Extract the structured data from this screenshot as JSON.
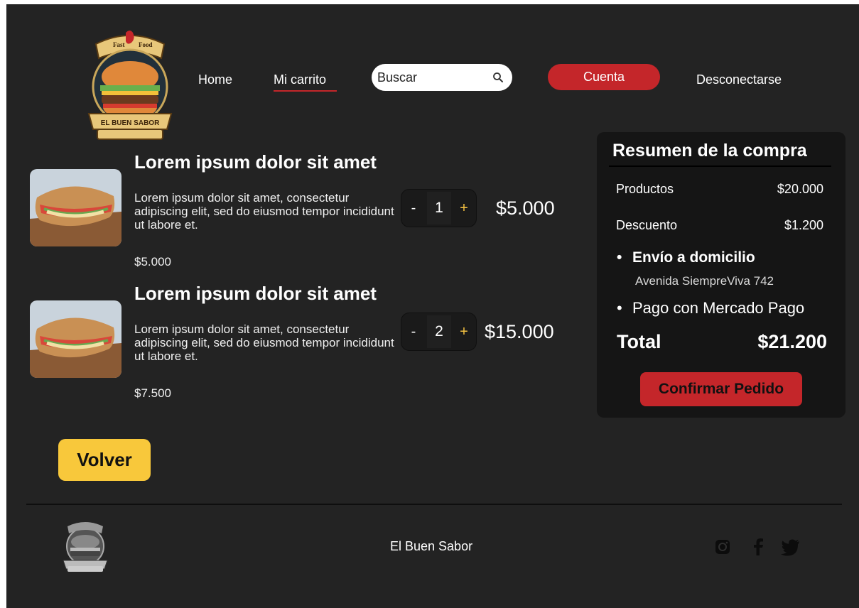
{
  "brand": {
    "logo_top_text_left": "Fast",
    "logo_top_text_right": "Food",
    "logo_banner_text": "EL BUEN SABOR"
  },
  "nav": {
    "home": "Home",
    "cart": "Mi carrito",
    "search_placeholder": "Buscar",
    "account": "Cuenta",
    "logout": "Desconectarse"
  },
  "cart": {
    "items": [
      {
        "title": "Lorem ipsum dolor sit amet",
        "description": "Lorem ipsum dolor sit amet, consectetur adipiscing elit, sed do eiusmod tempor incididunt ut labore et.",
        "unit_price": "$5.000",
        "minus": "-",
        "quantity": "1",
        "plus": "+",
        "line_total": "$5.000"
      },
      {
        "title": "Lorem ipsum dolor sit amet",
        "description": "Lorem ipsum dolor sit amet, consectetur adipiscing elit, sed do eiusmod tempor incididunt ut labore et.",
        "unit_price": "$7.500",
        "minus": "-",
        "quantity": "2",
        "plus": "+",
        "line_total": "$15.000"
      }
    ]
  },
  "summary": {
    "title": "Resumen de la compra",
    "products_label": "Productos",
    "products_value": "$20.000",
    "discount_label": "Descuento",
    "discount_value": "$1.200",
    "delivery_label": "Envío a domicilio",
    "delivery_address": "Avenida SiempreViva 742",
    "payment_label": "Pago con Mercado Pago",
    "total_label": "Total",
    "total_value": "$21.200",
    "confirm_button": "Confirmar Pedido"
  },
  "back_button": "Volver",
  "footer": {
    "brand_name": "El Buen Sabor",
    "social": [
      "instagram-icon",
      "facebook-icon",
      "twitter-icon"
    ]
  },
  "colors": {
    "background": "#232323",
    "accent_red": "#c4262a",
    "accent_yellow": "#f8c83b",
    "panel": "#151515"
  }
}
